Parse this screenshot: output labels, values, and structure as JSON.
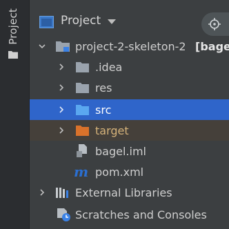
{
  "sidebar": {
    "tab_label": "Project"
  },
  "header": {
    "title": "Project"
  },
  "tree": {
    "root": {
      "name": "project-2-skeleton-2",
      "module": "[bagel"
    },
    "idea": {
      "name": ".idea"
    },
    "res": {
      "name": "res"
    },
    "src": {
      "name": "src",
      "selected": true
    },
    "target": {
      "name": "target",
      "excluded": true
    },
    "bagel_iml": {
      "name": "bagel.iml"
    },
    "pom_xml": {
      "name": "pom.xml"
    },
    "external_libraries": {
      "name": "External Libraries"
    },
    "scratches": {
      "name": "Scratches and Consoles"
    }
  },
  "colors": {
    "selection": "#2f65ca",
    "excluded_bg": "#45403a",
    "folder": "#9aa3ad",
    "excluded_folder": "#d9722b",
    "maven": "#2b6fd1"
  },
  "icons": {
    "sidebar": "project-folder-icon",
    "header": "project-view-icon",
    "header_button": "locate-target-icon",
    "root": "module-folder-icon",
    "folder": "folder-icon",
    "iml": "iml-file-icon",
    "pom": "maven-icon",
    "libraries": "libraries-icon",
    "scratches": "scratches-icon"
  }
}
